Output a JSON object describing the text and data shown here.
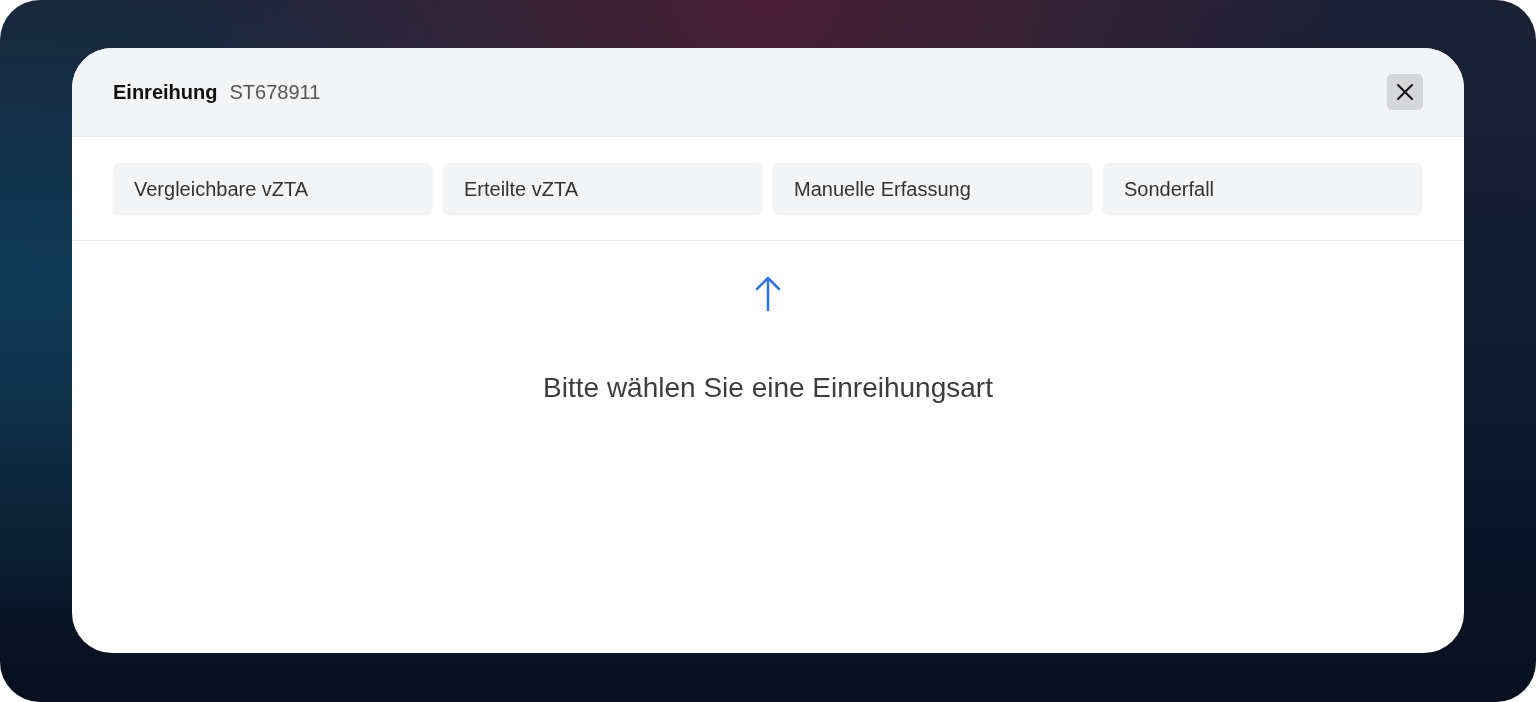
{
  "dialog": {
    "title": "Einreihung",
    "reference": "ST678911"
  },
  "tabs": [
    {
      "label": "Vergleichbare vZTA",
      "selected": false
    },
    {
      "label": "Erteilte vZTA",
      "selected": false
    },
    {
      "label": "Manuelle Erfassung",
      "selected": false
    },
    {
      "label": "Sonderfall",
      "selected": false
    }
  ],
  "empty_state": {
    "message": "Bitte wählen Sie eine Einreihungsart"
  }
}
